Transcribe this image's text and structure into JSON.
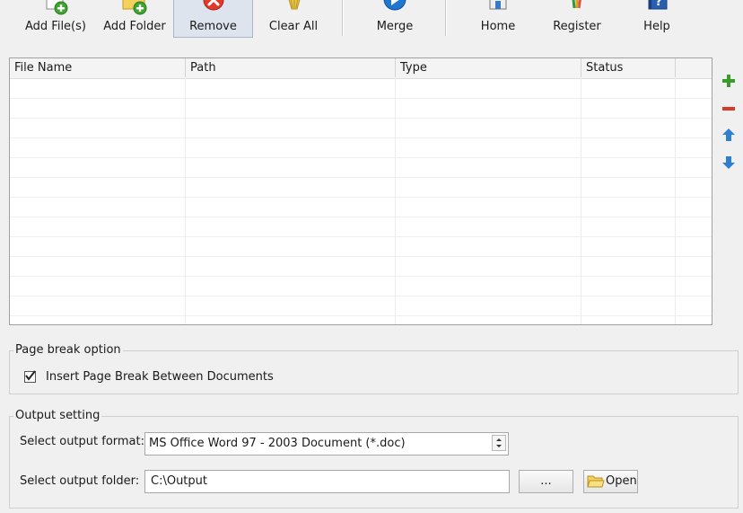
{
  "toolbar": {
    "add_files": "Add File(s)",
    "add_folder": "Add Folder",
    "remove": "Remove",
    "clear_all": "Clear All",
    "merge": "Merge",
    "home": "Home",
    "register": "Register",
    "help": "Help"
  },
  "file_list": {
    "columns": [
      "File Name",
      "Path",
      "Type",
      "Status"
    ]
  },
  "page_break": {
    "group_title": "Page break option",
    "checkbox_label": "Insert Page Break Between Documents",
    "checked": true
  },
  "output": {
    "group_title": "Output setting",
    "format_label": "Select output format:",
    "format_value": "MS Office Word 97 - 2003 Document (*.doc)",
    "folder_label": "Select output folder:",
    "folder_value": "C:\\Output",
    "browse_label": "...",
    "open_label": "Open"
  },
  "colors": {
    "add": "#3a9a2a",
    "remove": "#d83a2a",
    "arrow": "#2e7fd0"
  }
}
